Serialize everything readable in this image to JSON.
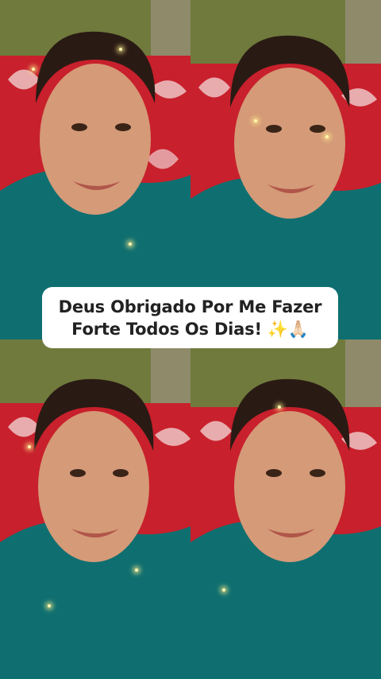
{
  "caption": {
    "line1": "Deus Obrigado Por Me Fazer",
    "line2": "Forte Todos Os Dias! ✨🙏🏻"
  },
  "colors": {
    "curtain": "#6f7a3c",
    "sofa_red": "#c8202c",
    "shirt_teal": "#0f6f70",
    "skin": "#d59a78",
    "hair": "#2a1a14"
  }
}
